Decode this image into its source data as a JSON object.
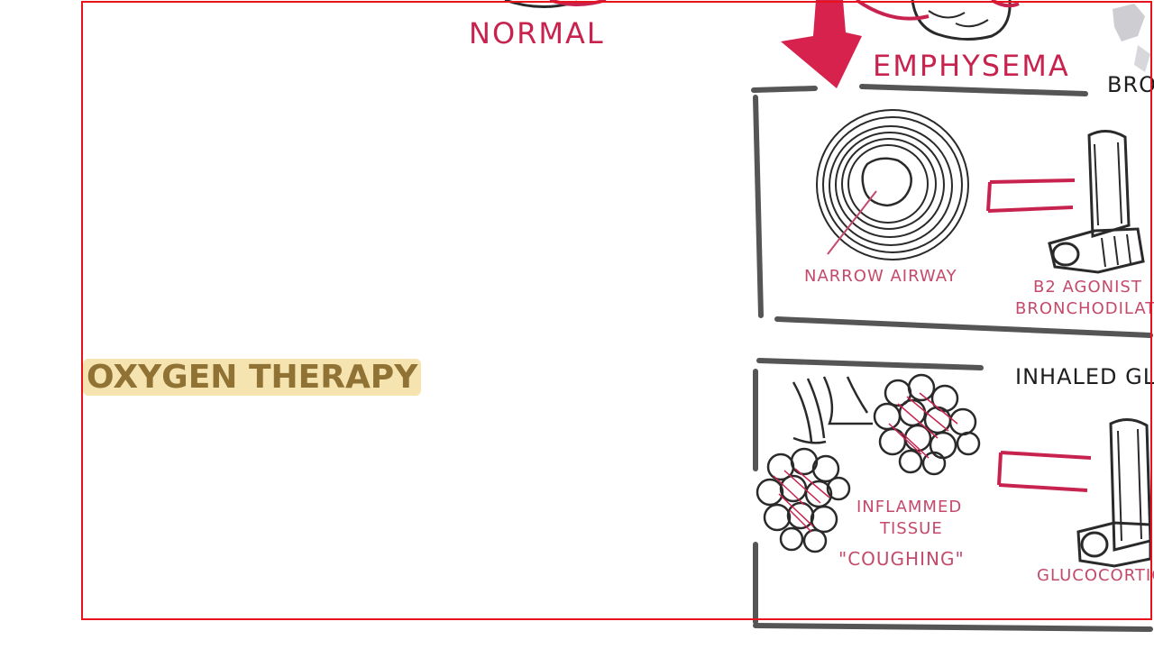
{
  "labels": {
    "normal": "NORMAL",
    "emphysema": "EMPHYSEMA",
    "bronch_partial": "BRO",
    "narrow_airway": "NARROW AIRWAY",
    "b2_agonist": "B2 AGONIST",
    "bronchodilator": "BRONCHODILATO",
    "inhaled_partial": "INHALED GLU",
    "inflamed": "INFLAMMED",
    "tissue": "TISSUE",
    "coughing": "\"COUGHING\"",
    "glucocorticoid": "GLUCOCORTIC",
    "oxygen_therapy": "OXYGEN THERAPY"
  },
  "colors": {
    "accent_red": "#c8234f",
    "frame_red": "#e8121c",
    "ink": "#2a2a2a",
    "panel_border": "#555555",
    "highlight": "#f6e4b0",
    "oxygen_text": "#8f7234"
  }
}
